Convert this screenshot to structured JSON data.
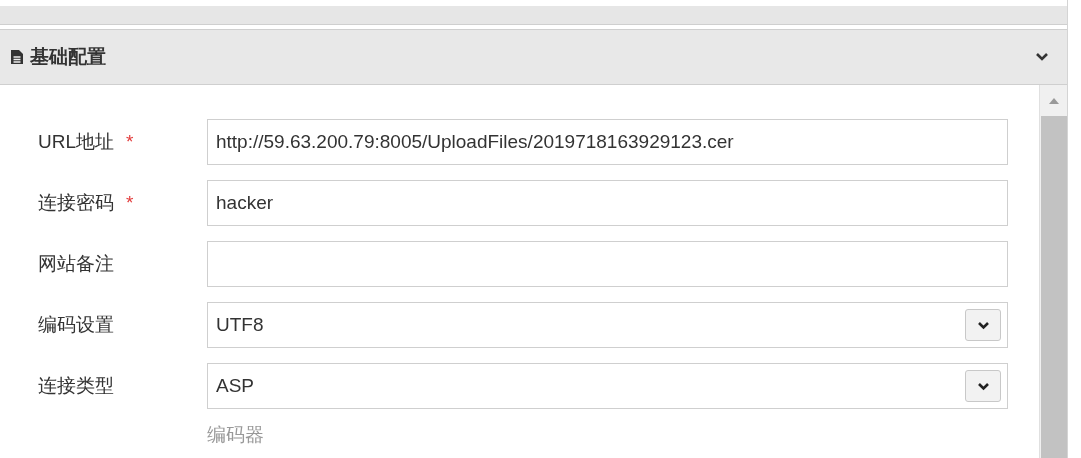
{
  "panel": {
    "title": "基础配置",
    "expanded": true
  },
  "fields": [
    {
      "kind": "text",
      "label": "URL地址",
      "required": true,
      "value": "http://59.63.200.79:8005/UploadFiles/2019718163929123.cer"
    },
    {
      "kind": "text",
      "label": "连接密码",
      "required": true,
      "value": "hacker"
    },
    {
      "kind": "text",
      "label": "网站备注",
      "required": false
    },
    {
      "kind": "select",
      "label": "编码设置",
      "required": false,
      "value": "UTF8"
    },
    {
      "kind": "select",
      "label": "连接类型",
      "required": false,
      "value": "ASP"
    }
  ],
  "required_mark": "*",
  "section_label": "编码器"
}
